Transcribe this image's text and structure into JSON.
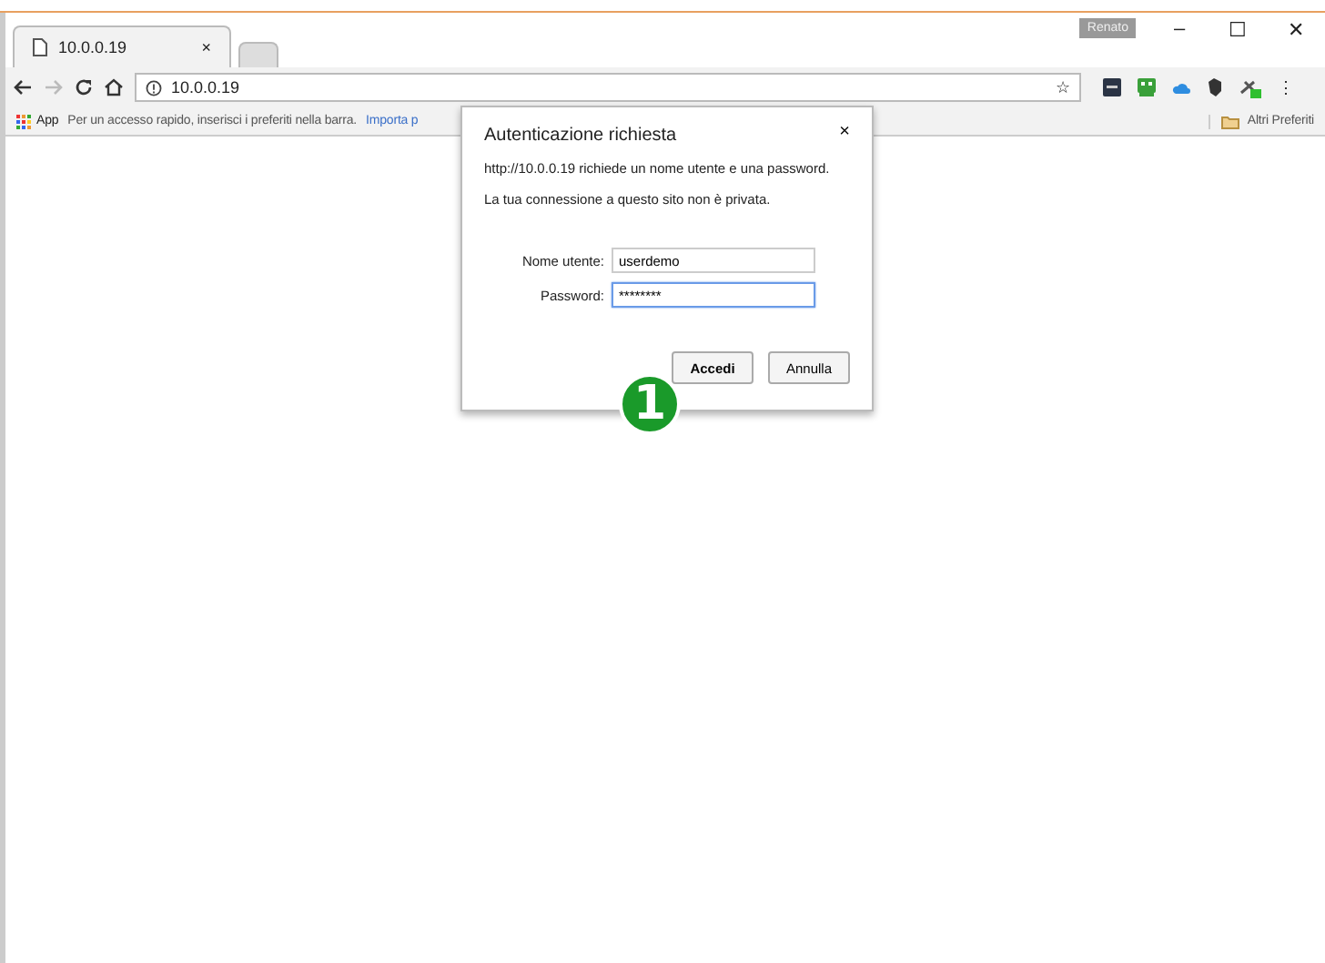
{
  "window": {
    "profile": "Renato",
    "controls": [
      "–",
      "☐",
      "✕"
    ]
  },
  "tabs": [
    {
      "title": "10.0.0.19",
      "close": "×",
      "selected": true
    },
    {
      "selected": false
    }
  ],
  "toolbar": {
    "address": "10.0.0.19",
    "star": "☆",
    "menu": "⋮"
  },
  "bookmarks_bar": {
    "apps": "App",
    "hint": "Per un accesso rapido, inserisci i preferiti nella barra.",
    "import_link": "Importa p",
    "other": "Altri Preferiti"
  },
  "dialog": {
    "title": "Autenticazione richiesta",
    "close": "×",
    "message": "http://10.0.0.19 richiede un nome utente e una password.",
    "notice": "La tua connessione a questo sito non è privata.",
    "fields": [
      {
        "label": "Nome utente:",
        "value": "userdemo",
        "focused": false
      },
      {
        "label": "Password:",
        "value": "********",
        "focused": true
      }
    ],
    "buttons": [
      {
        "label": "Accedi",
        "default": true
      },
      {
        "label": "Annulla",
        "default": false
      }
    ]
  },
  "step_badge": "1"
}
